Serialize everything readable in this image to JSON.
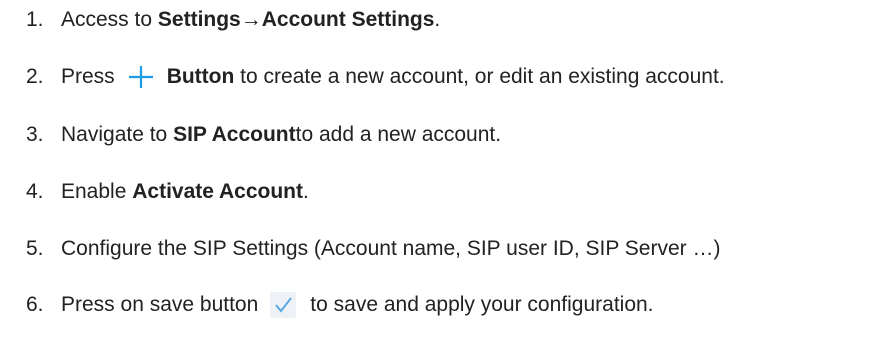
{
  "steps": [
    {
      "number": "1.",
      "parts": [
        "Access to ",
        "Settings",
        " → ",
        "Account Settings",
        "."
      ]
    },
    {
      "number": "2.",
      "icon": "plus-icon",
      "parts": [
        "Press",
        "Button",
        " to create a new account, or edit an existing account."
      ]
    },
    {
      "number": "3.",
      "parts": [
        "Navigate to ",
        "SIP Account",
        " to add a new account."
      ]
    },
    {
      "number": "4.",
      "parts": [
        "Enable ",
        "Activate Account",
        "."
      ]
    },
    {
      "number": "5.",
      "parts": [
        "Configure the SIP Settings (Account name, SIP user ID, SIP Server …)"
      ]
    },
    {
      "number": "6.",
      "icon": "check-icon",
      "parts": [
        "Press on save button",
        "to save and apply your configuration."
      ]
    }
  ],
  "colors": {
    "text": "#222222",
    "plus_icon": "#1e9be6",
    "check_icon_bg": "#eef2f7",
    "check_icon_mark": "#5aa9e6"
  }
}
